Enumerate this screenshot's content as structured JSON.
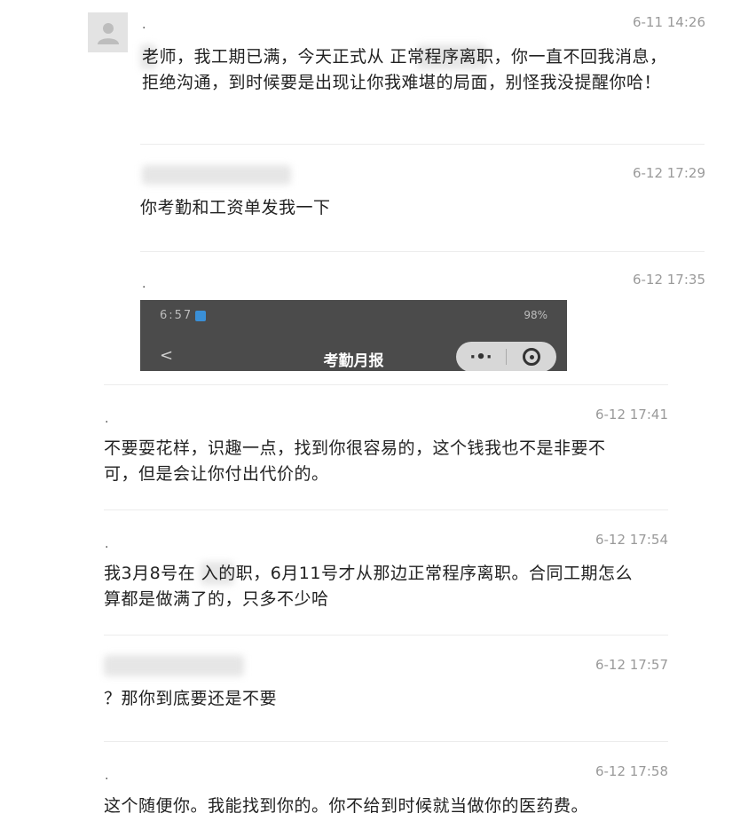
{
  "messages": [
    {
      "dot": ".",
      "time": "6-11 14:26",
      "text": "老师，我工期已满，今天正式从 正常程序离职，你一直不回我消息，拒绝沟通，到时候要是出现让你我难堪的局面，别怪我没提醒你哈！"
    },
    {
      "dot": "",
      "time": "6-12 17:29",
      "text": "你考勤和工资单发我一下"
    },
    {
      "dot": ".",
      "time": "6-12 17:35",
      "text": ""
    },
    {
      "dot": ".",
      "time": "6-12 17:41",
      "text": "不要耍花样，识趣一点，找到你很容易的，这个钱我也不是非要不可，但是会让你付出代价的。"
    },
    {
      "dot": ".",
      "time": "6-12 17:54",
      "text": "我3月8号在 入的职，6月11号才从那边正常程序离职。合同工期怎么算都是做满了的，只多不少哈"
    },
    {
      "dot": "",
      "time": "6-12 17:57",
      "text": "？那你到底要还是不要"
    },
    {
      "dot": ".",
      "time": "6-12 17:58",
      "text": "这个随便你。我能找到你的。你不给到时候就当做你的医药费。"
    }
  ],
  "screenshot": {
    "status_time": "6:57",
    "status_right": "98%",
    "back_glyph": "<",
    "title": "考勤月报",
    "more_glyph": "·•·",
    "icon_shield": "shield-icon",
    "icon_close": "target-icon"
  },
  "icons": {
    "avatar": "person-silhouette-icon"
  },
  "colors": {
    "time": "#9a9a9a",
    "divider": "#ececec",
    "screenshot_bg": "#4b4b4b"
  }
}
